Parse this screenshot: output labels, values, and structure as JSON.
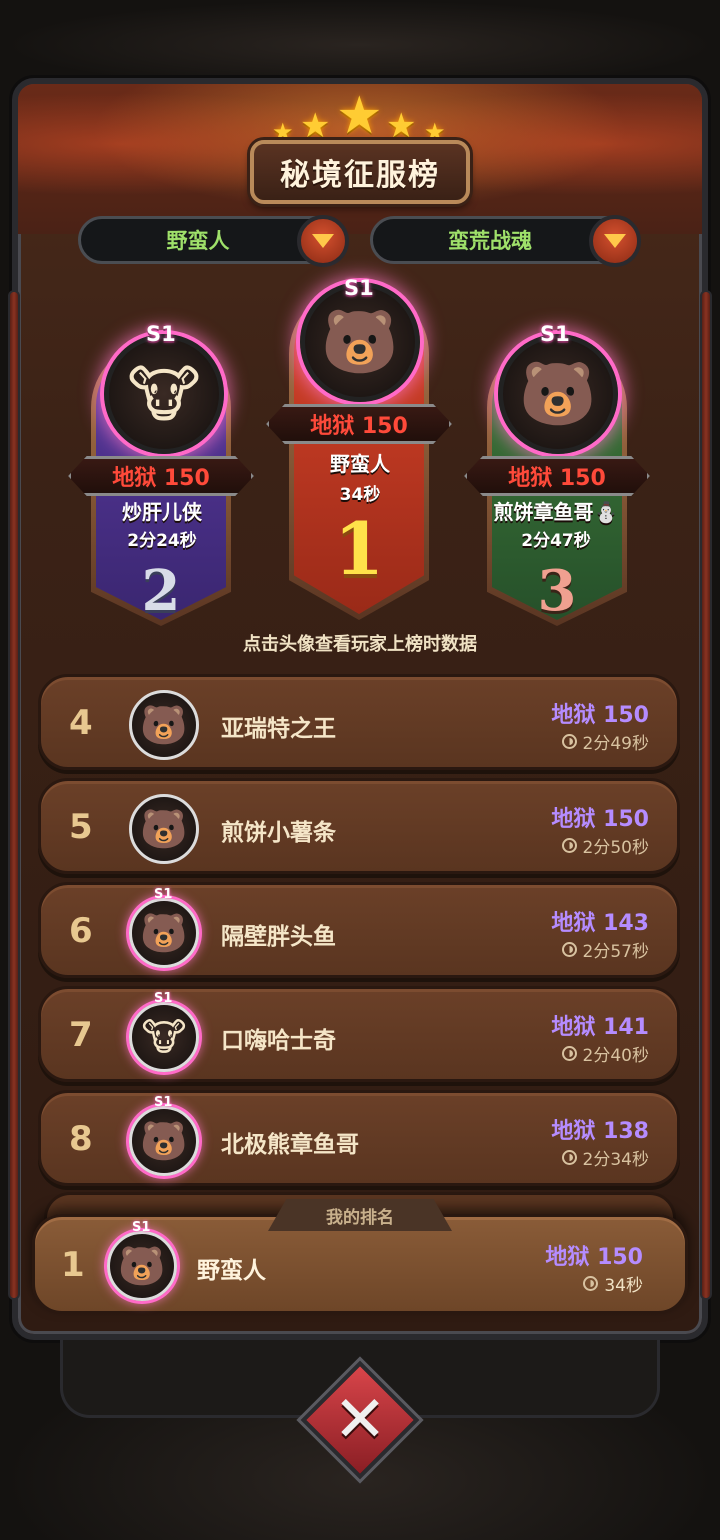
{
  "title": "秘境征服榜",
  "filters": {
    "class": "野蛮人",
    "mode": "蛮荒战魂"
  },
  "podium": [
    {
      "rank": "1",
      "badge": "S1",
      "difficulty": "地狱 150",
      "name": "野蛮人",
      "time": "34秒",
      "avatar": "bear-avatar"
    },
    {
      "rank": "2",
      "badge": "S1",
      "difficulty": "地狱 150",
      "name": "炒肝儿侠",
      "time": "2分24秒",
      "avatar": "cow-avatar"
    },
    {
      "rank": "3",
      "badge": "S1",
      "difficulty": "地狱 150",
      "name": "煎饼章鱼哥⛄",
      "time": "2分47秒",
      "avatar": "helmet-bear-avatar"
    }
  ],
  "hint": "点击头像查看玩家上榜时数据",
  "list": [
    {
      "rank": "4",
      "name": "亚瑞特之王",
      "difficulty": "地狱 150",
      "time": "2分49秒",
      "s1": "",
      "avatar": "🐻"
    },
    {
      "rank": "5",
      "name": "煎饼小薯条",
      "difficulty": "地狱 150",
      "time": "2分50秒",
      "s1": "",
      "avatar": "🐻"
    },
    {
      "rank": "6",
      "name": "隔壁胖头鱼",
      "difficulty": "地狱 143",
      "time": "2分57秒",
      "s1": "S1",
      "avatar": "🐻"
    },
    {
      "rank": "7",
      "name": "口嗨哈士奇",
      "difficulty": "地狱 141",
      "time": "2分40秒",
      "s1": "S1",
      "avatar": "🐮"
    },
    {
      "rank": "8",
      "name": "北极熊章鱼哥",
      "difficulty": "地狱 138",
      "time": "2分34秒",
      "s1": "S1",
      "avatar": "🐻"
    }
  ],
  "my_rank": {
    "tab": "我的排名",
    "rank": "1",
    "s1": "S1",
    "name": "野蛮人",
    "difficulty": "地狱 150",
    "time": "34秒",
    "avatar": "🐻"
  },
  "avatars": {
    "bear": "🐻",
    "cow": "🐮"
  },
  "colors": {
    "difficulty_list": "#b58cff",
    "difficulty_podium": "#ff4a3a",
    "filter_text": "#9fe06a"
  }
}
